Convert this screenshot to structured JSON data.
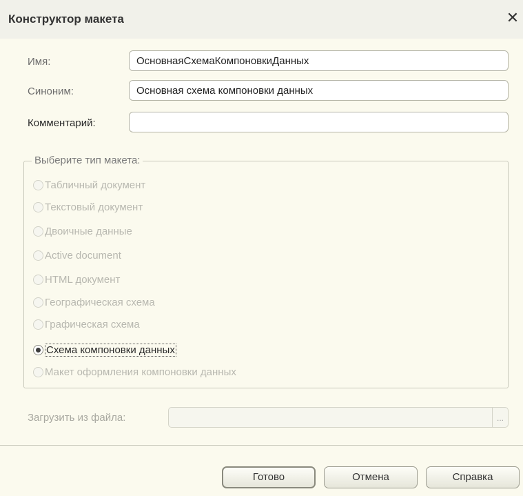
{
  "window": {
    "title": "Конструктор макета",
    "close_glyph": "✕"
  },
  "form": {
    "name_label": "Имя:",
    "name_value": "ОсновнаяСхемаКомпоновкиДанных",
    "synonym_label": "Синоним:",
    "synonym_value": "Основная схема компоновки данных",
    "comment_label": "Комментарий:",
    "comment_value": ""
  },
  "layout_type": {
    "legend": "Выберите тип макета:",
    "options": [
      {
        "label": "Табличный документ",
        "checked": false,
        "enabled": false
      },
      {
        "label": "Текстовый документ",
        "checked": false,
        "enabled": false
      },
      {
        "label": "Двоичные данные",
        "checked": false,
        "enabled": false
      },
      {
        "label": "Active document",
        "checked": false,
        "enabled": false
      },
      {
        "label": "HTML документ",
        "checked": false,
        "enabled": false
      },
      {
        "label": "Географическая схема",
        "checked": false,
        "enabled": false
      },
      {
        "label": "Графическая схема",
        "checked": false,
        "enabled": false
      },
      {
        "label": "Схема компоновки данных",
        "checked": true,
        "enabled": true
      },
      {
        "label": "Макет оформления компоновки данных",
        "checked": false,
        "enabled": false
      }
    ]
  },
  "file": {
    "label": "Загрузить из файла:",
    "value": "",
    "browse_glyph": "..."
  },
  "buttons": {
    "ok": "Готово",
    "cancel": "Отмена",
    "help": "Справка"
  }
}
